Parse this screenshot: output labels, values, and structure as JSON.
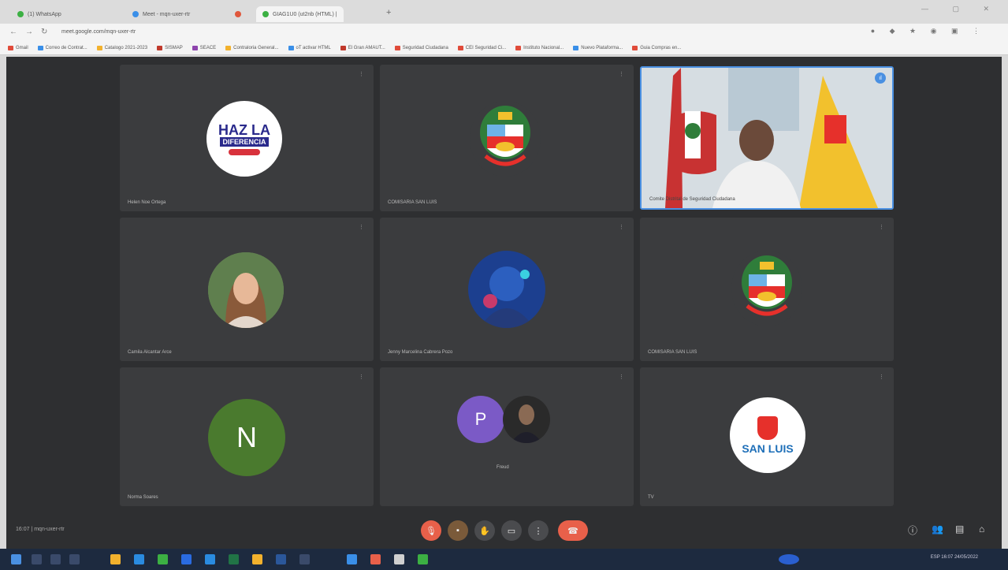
{
  "browser": {
    "tabs": [
      {
        "label": "(1) WhatsApp",
        "color": "#3cb043"
      },
      {
        "label": "Meet - mqn-uxer-rtr",
        "color": "#3a8fe8"
      },
      {
        "label": "",
        "color": "#e0573c"
      },
      {
        "label": "GIAG1U0 (ut2nb (HTML) |",
        "color": "#3cb043"
      }
    ],
    "url": "meet.google.com/mqn-uxer-rtr",
    "bookmarks": [
      {
        "label": "Gmail",
        "color": "#e04b3a"
      },
      {
        "label": "Correo de Contrat...",
        "color": "#3a8fe8"
      },
      {
        "label": "Catalogo 2021-2023",
        "color": "#f2b12d"
      },
      {
        "label": "SISMAP",
        "color": "#c0392b"
      },
      {
        "label": "SEACE",
        "color": "#8e44ad"
      },
      {
        "label": "Contraloria General...",
        "color": "#f2b12d"
      },
      {
        "label": "oT activar HTML",
        "color": "#3a8fe8"
      },
      {
        "label": "El Gran AMAUT...",
        "color": "#c0392b"
      },
      {
        "label": "Seguridad Ciudadana",
        "color": "#e04b3a"
      },
      {
        "label": "CEI Seguridad Ci...",
        "color": "#e04b3a"
      },
      {
        "label": "Instituto Nacional...",
        "color": "#e04b3a"
      },
      {
        "label": "Nuevo Plataforma...",
        "color": "#3a8fe8"
      },
      {
        "label": "Guia Compras en...",
        "color": "#e04b3a"
      }
    ]
  },
  "meet": {
    "tiles": [
      {
        "name": "Helen Noe Ortega",
        "avatar": "haz-la-diferencia-logo",
        "avatar_text": [
          "HAZ LA",
          "DIFERENCIA"
        ]
      },
      {
        "name": "COMISARIA SAN LUIS",
        "avatar": "peru-coat-of-arms"
      },
      {
        "name": "Comite Distrital de Seguridad Ciudadana",
        "avatar": "video-feed"
      },
      {
        "name": "Camila Alcantar Arce",
        "avatar": "photo-woman"
      },
      {
        "name": "Jenny Marcelina Cabrera Pozo",
        "avatar": "photo-blue"
      },
      {
        "name": "COMISARIA SAN LUIS",
        "avatar": "peru-coat-of-arms"
      },
      {
        "name": "Norma Soares",
        "avatar": "letter",
        "letter": "N",
        "color": "#4a7a2e"
      },
      {
        "name": "Freud",
        "avatar": "letter-and-photo",
        "letter": "P",
        "color": "#7b5ac6"
      },
      {
        "name": "TV",
        "avatar": "san-luis-logo",
        "avatar_text": "SAN LUIS"
      }
    ],
    "time_text": "16:07 | mqn-uxer-rtr",
    "controls": [
      "mic-off",
      "camera",
      "hand",
      "present",
      "more",
      "end-call"
    ]
  },
  "taskbar": {
    "tray_text": "ESP 16:07 24/05/2022"
  }
}
